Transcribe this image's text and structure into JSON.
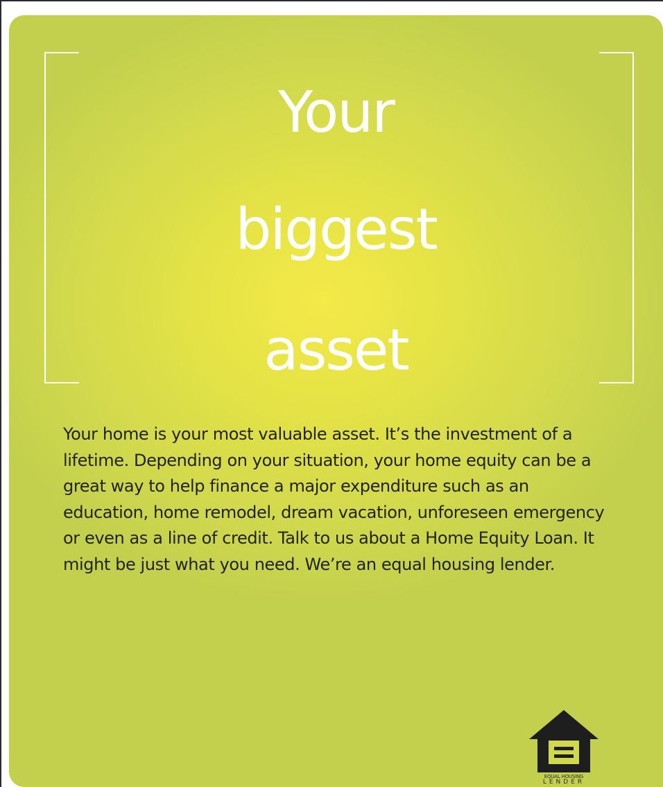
{
  "headline": {
    "line1": "Your",
    "line2": "biggest",
    "line3": "asset"
  },
  "body": "Your home is your most valuable asset. It’s the investment of a lifetime. Depending on your situation, your home equity can be a great way to help finance a major expenditure such as an education, home remodel, dream vacation, unforeseen emergency or even as a line of credit. Talk to us about a Home Equity Loan. It might be just what you need. We’re an equal housing lender.",
  "logo": {
    "icon": "equal-housing-house-icon",
    "line1": "EQUAL HOUSING",
    "line2": "LENDER"
  },
  "colors": {
    "background_center": "#f4ea48",
    "background_edge": "#c3d04d",
    "headline": "#ffffff",
    "body_text": "#222222"
  }
}
